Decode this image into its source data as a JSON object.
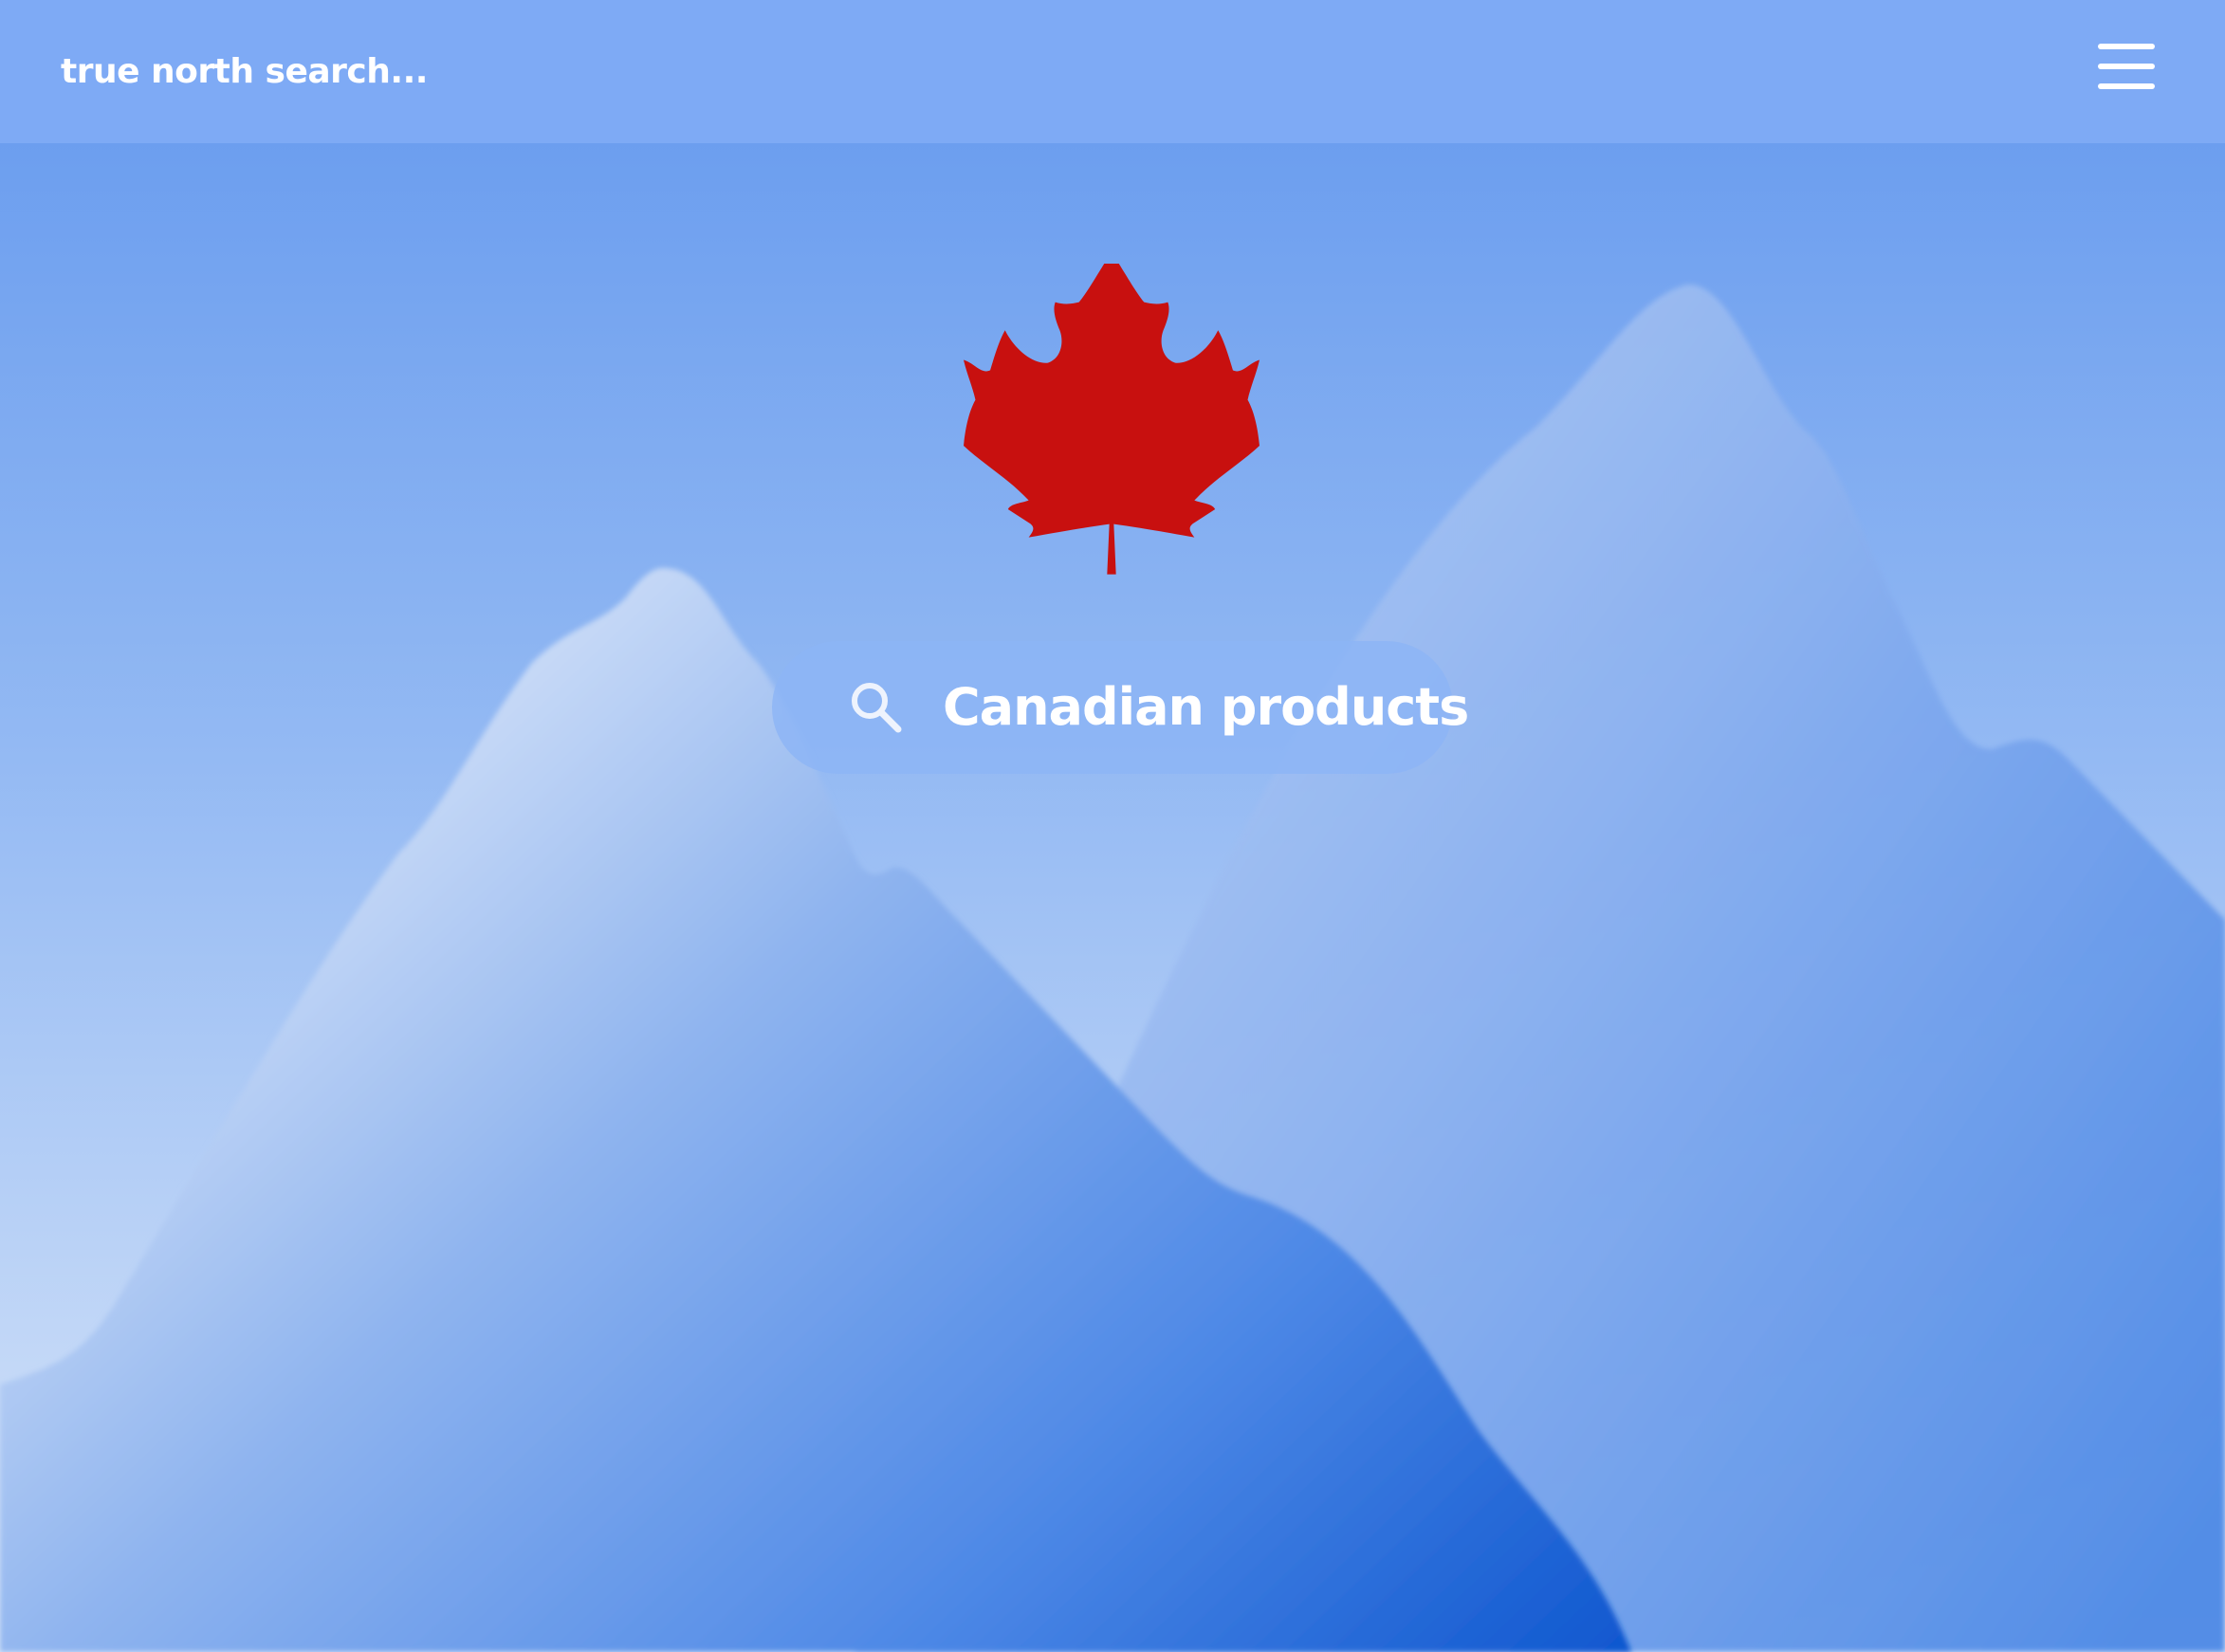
{
  "header": {
    "brand": "true north search...",
    "menu_icon": "hamburger-menu-icon"
  },
  "logo": {
    "icon": "maple-leaf-icon",
    "color": "#c8100f"
  },
  "search": {
    "icon": "search-icon",
    "value": "Canadian products"
  },
  "colors": {
    "topbar": "#7eaaf5",
    "sky_top": "#6b9ff0",
    "mountain_dark": "#1a5fd4",
    "text": "#ffffff"
  }
}
